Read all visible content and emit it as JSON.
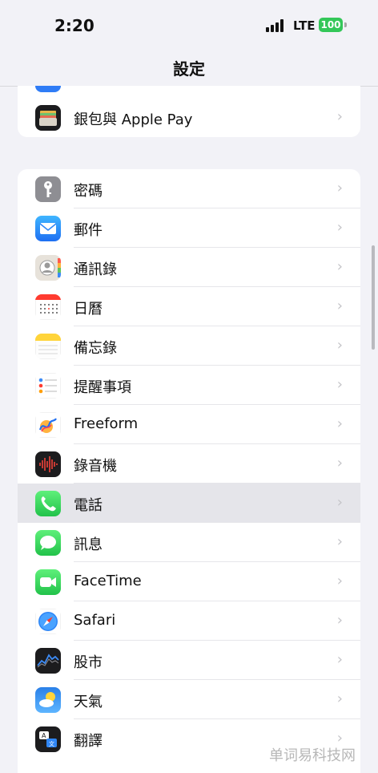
{
  "status_bar": {
    "time": "2:20",
    "network": "LTE",
    "battery": "100"
  },
  "header": {
    "title": "設定"
  },
  "top_group": {
    "partial_label": "·  ¦",
    "items": [
      {
        "label": "銀包與 Apple Pay",
        "icon": "wallet-icon"
      }
    ]
  },
  "main_group": {
    "items": [
      {
        "label": "密碼",
        "icon": "key-icon"
      },
      {
        "label": "郵件",
        "icon": "mail-icon"
      },
      {
        "label": "通訊錄",
        "icon": "contacts-icon"
      },
      {
        "label": "日曆",
        "icon": "calendar-icon"
      },
      {
        "label": "備忘錄",
        "icon": "notes-icon"
      },
      {
        "label": "提醒事項",
        "icon": "reminders-icon"
      },
      {
        "label": "Freeform",
        "icon": "freeform-icon"
      },
      {
        "label": "錄音機",
        "icon": "voice-memos-icon"
      },
      {
        "label": "電話",
        "icon": "phone-icon"
      },
      {
        "label": "訊息",
        "icon": "messages-icon"
      },
      {
        "label": "FaceTime",
        "icon": "facetime-icon"
      },
      {
        "label": "Safari",
        "icon": "safari-icon"
      },
      {
        "label": "股市",
        "icon": "stocks-icon"
      },
      {
        "label": "天氣",
        "icon": "weather-icon"
      },
      {
        "label": "翻譯",
        "icon": "translate-icon"
      }
    ]
  },
  "chevron": "›",
  "watermark": "单词易科技网"
}
